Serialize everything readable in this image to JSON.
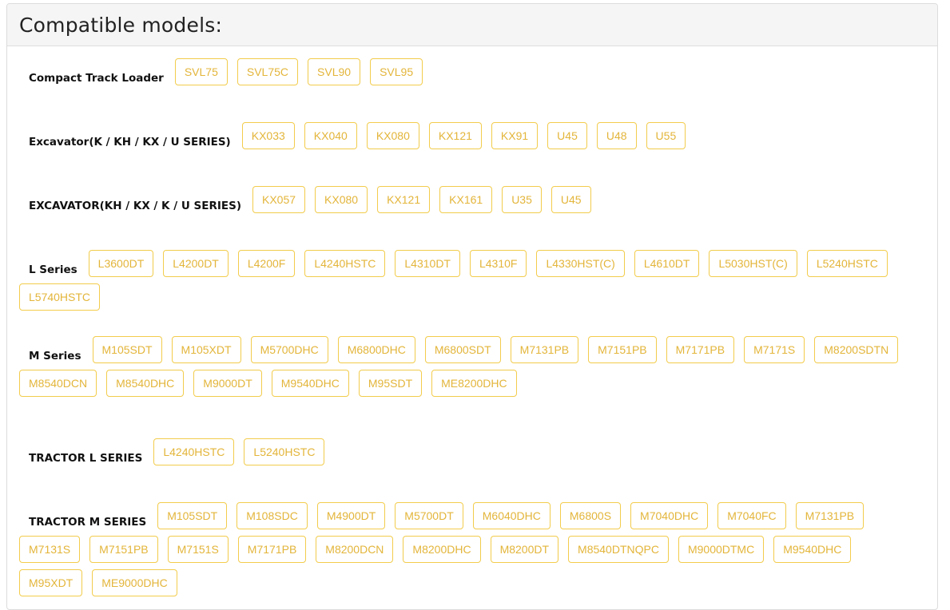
{
  "panel": {
    "title": "Compatible models:"
  },
  "groups": [
    {
      "label": "Compact Track Loader",
      "models": [
        "SVL75",
        "SVL75C",
        "SVL90",
        "SVL95"
      ]
    },
    {
      "label": "Excavator(K / KH / KX / U SERIES)",
      "models": [
        "KX033",
        "KX040",
        "KX080",
        "KX121",
        "KX91",
        "U45",
        "U48",
        "U55"
      ]
    },
    {
      "label": "EXCAVATOR(KH / KX / K / U SERIES)",
      "models": [
        "KX057",
        "KX080",
        "KX121",
        "KX161",
        "U35",
        "U45"
      ]
    },
    {
      "label": "L Series",
      "models": [
        "L3600DT",
        "L4200DT",
        "L4200F",
        "L4240HSTC",
        "L4310DT",
        "L4310F",
        "L4330HST(C)",
        "L4610DT",
        "L5030HST(C)",
        "L5240HSTC",
        "L5740HSTC"
      ]
    },
    {
      "label": "M Series",
      "models": [
        "M105SDT",
        "M105XDT",
        "M5700DHC",
        "M6800DHC",
        "M6800SDT",
        "M7131PB",
        "M7151PB",
        "M7171PB",
        "M7171S",
        "M8200SDTN",
        "M8540DCN",
        "M8540DHC",
        "M9000DT",
        "M9540DHC",
        "M95SDT",
        "ME8200DHC"
      ]
    },
    {
      "label": "TRACTOR L SERIES",
      "models": [
        "L4240HSTC",
        "L5240HSTC"
      ]
    },
    {
      "label": "TRACTOR M SERIES",
      "models": [
        "M105SDT",
        "M108SDC",
        "M4900DT",
        "M5700DT",
        "M6040DHC",
        "M6800S",
        "M7040DHC",
        "M7040FC",
        "M7131PB",
        "M7131S",
        "M7151PB",
        "M7151S",
        "M7171PB",
        "M8200DCN",
        "M8200DHC",
        "M8200DT",
        "M8540DTNQPC",
        "M9000DTMC",
        "M9540DHC",
        "M95XDT",
        "ME9000DHC"
      ]
    }
  ]
}
